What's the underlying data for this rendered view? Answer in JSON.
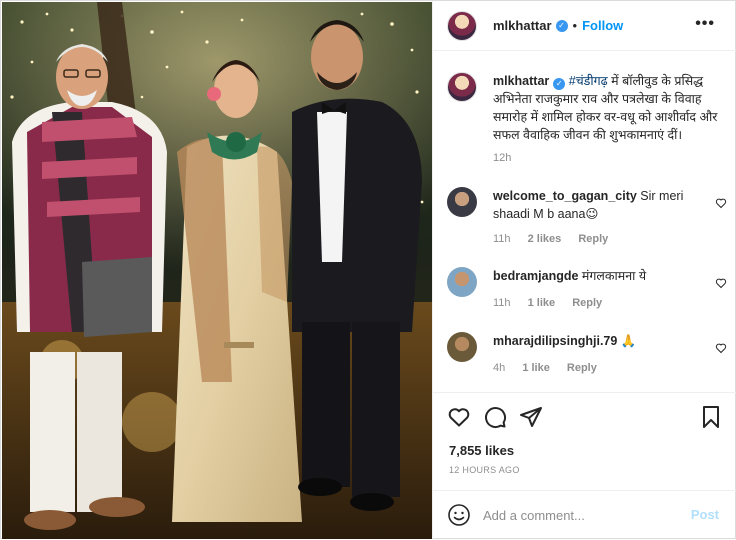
{
  "header": {
    "username": "mlkhattar",
    "separator": "•",
    "follow_label": "Follow",
    "more_label": "•••"
  },
  "caption": {
    "username": "mlkhattar",
    "hashtag": "#चंडीगढ़",
    "text": " में बॉलीवुड के प्रसिद्ध अभिनेता राजकुमार राव और पत्रलेखा के विवाह समारोह में शामिल होकर वर-वधू को आशीर्वाद और सफल वैवाहिक जीवन की शुभकामनाएं दीं।",
    "time": "12h"
  },
  "comments": [
    {
      "username": "welcome_to_gagan_city",
      "text": "Sir meri shaadi M b aana😉",
      "time": "11h",
      "likes": "2 likes",
      "reply": "Reply"
    },
    {
      "username": "bedramjangde",
      "text": "मंगलकामना ये",
      "time": "11h",
      "likes": "1 like",
      "reply": "Reply"
    },
    {
      "username": "mharajdilipsinghji.79",
      "text": "🙏",
      "time": "4h",
      "likes": "1 like",
      "reply": "Reply"
    }
  ],
  "actions": {
    "like_icon": "heart-icon",
    "comment_icon": "comment-icon",
    "share_icon": "share-icon",
    "save_icon": "bookmark-icon"
  },
  "likes_count": "7,855 likes",
  "time_ago": "12 HOURS AGO",
  "add_comment": {
    "placeholder": "Add a comment...",
    "post_label": "Post"
  },
  "colors": {
    "accent": "#0095f6",
    "verified": "#3897f0",
    "hashtag": "#00376b",
    "muted": "#8e8e8e",
    "post_disabled": "#b2dffc"
  }
}
